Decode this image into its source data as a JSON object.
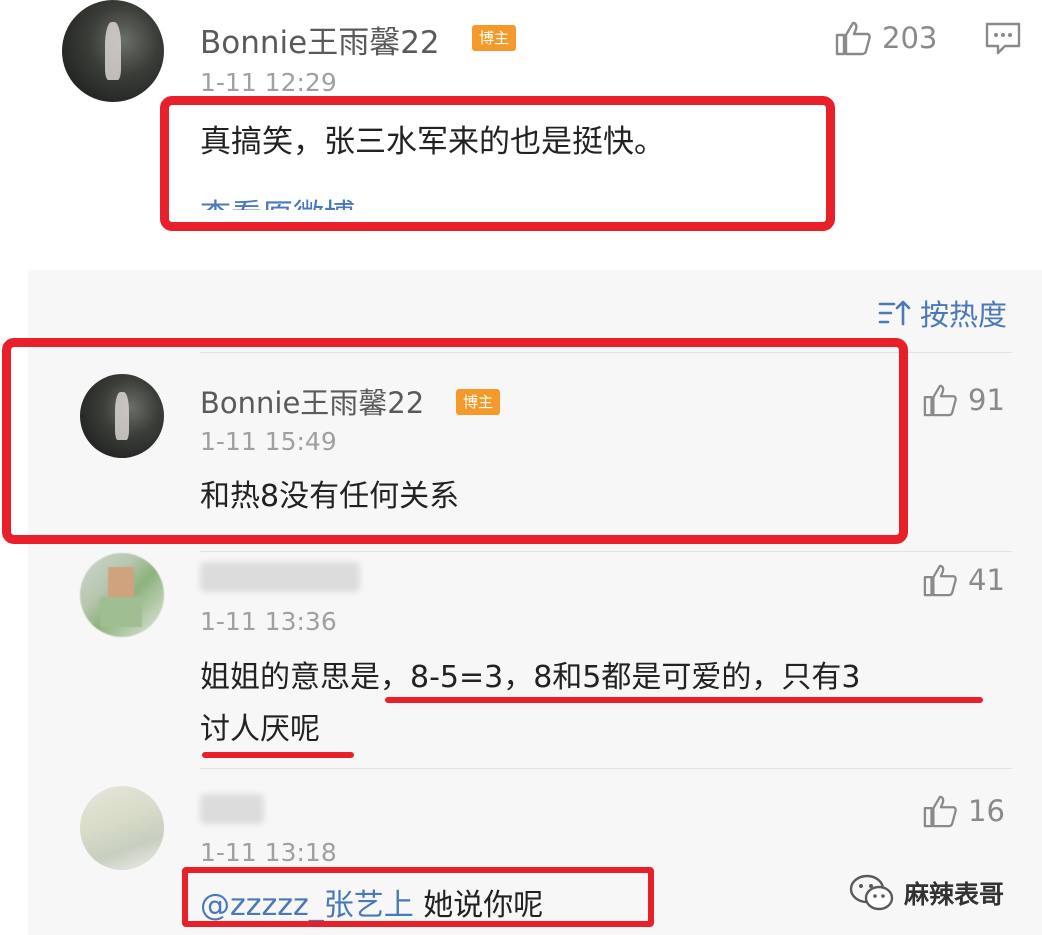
{
  "top_comment": {
    "user": "Bonnie王雨馨22",
    "badge": "博主",
    "time": "1-11 12:29",
    "likes": "203",
    "content": "真搞笑，张三水军来的也是挺快。",
    "view_original": "查看原微博"
  },
  "sort": {
    "label": "按热度"
  },
  "replies": [
    {
      "user": "Bonnie王雨馨22",
      "badge": "博主",
      "time": "1-11 15:49",
      "likes": "91",
      "content": "和热8没有任何关系"
    },
    {
      "user": "",
      "time": "1-11 13:36",
      "likes": "41",
      "content_line1": "姐姐的意思是，8-5=3，8和5都是可爱的，只有3",
      "content_line2": "讨人厌呢"
    },
    {
      "user": "",
      "time": "1-11 13:18",
      "likes": "16",
      "mention": "@zzzzz_张艺上",
      "content": " 她说你呢"
    }
  ],
  "watermark": {
    "label": "麻辣表哥"
  },
  "colors": {
    "annotation_red": "#e8202a",
    "badge_orange": "#f39a2a",
    "link_blue": "#4a78b8"
  }
}
